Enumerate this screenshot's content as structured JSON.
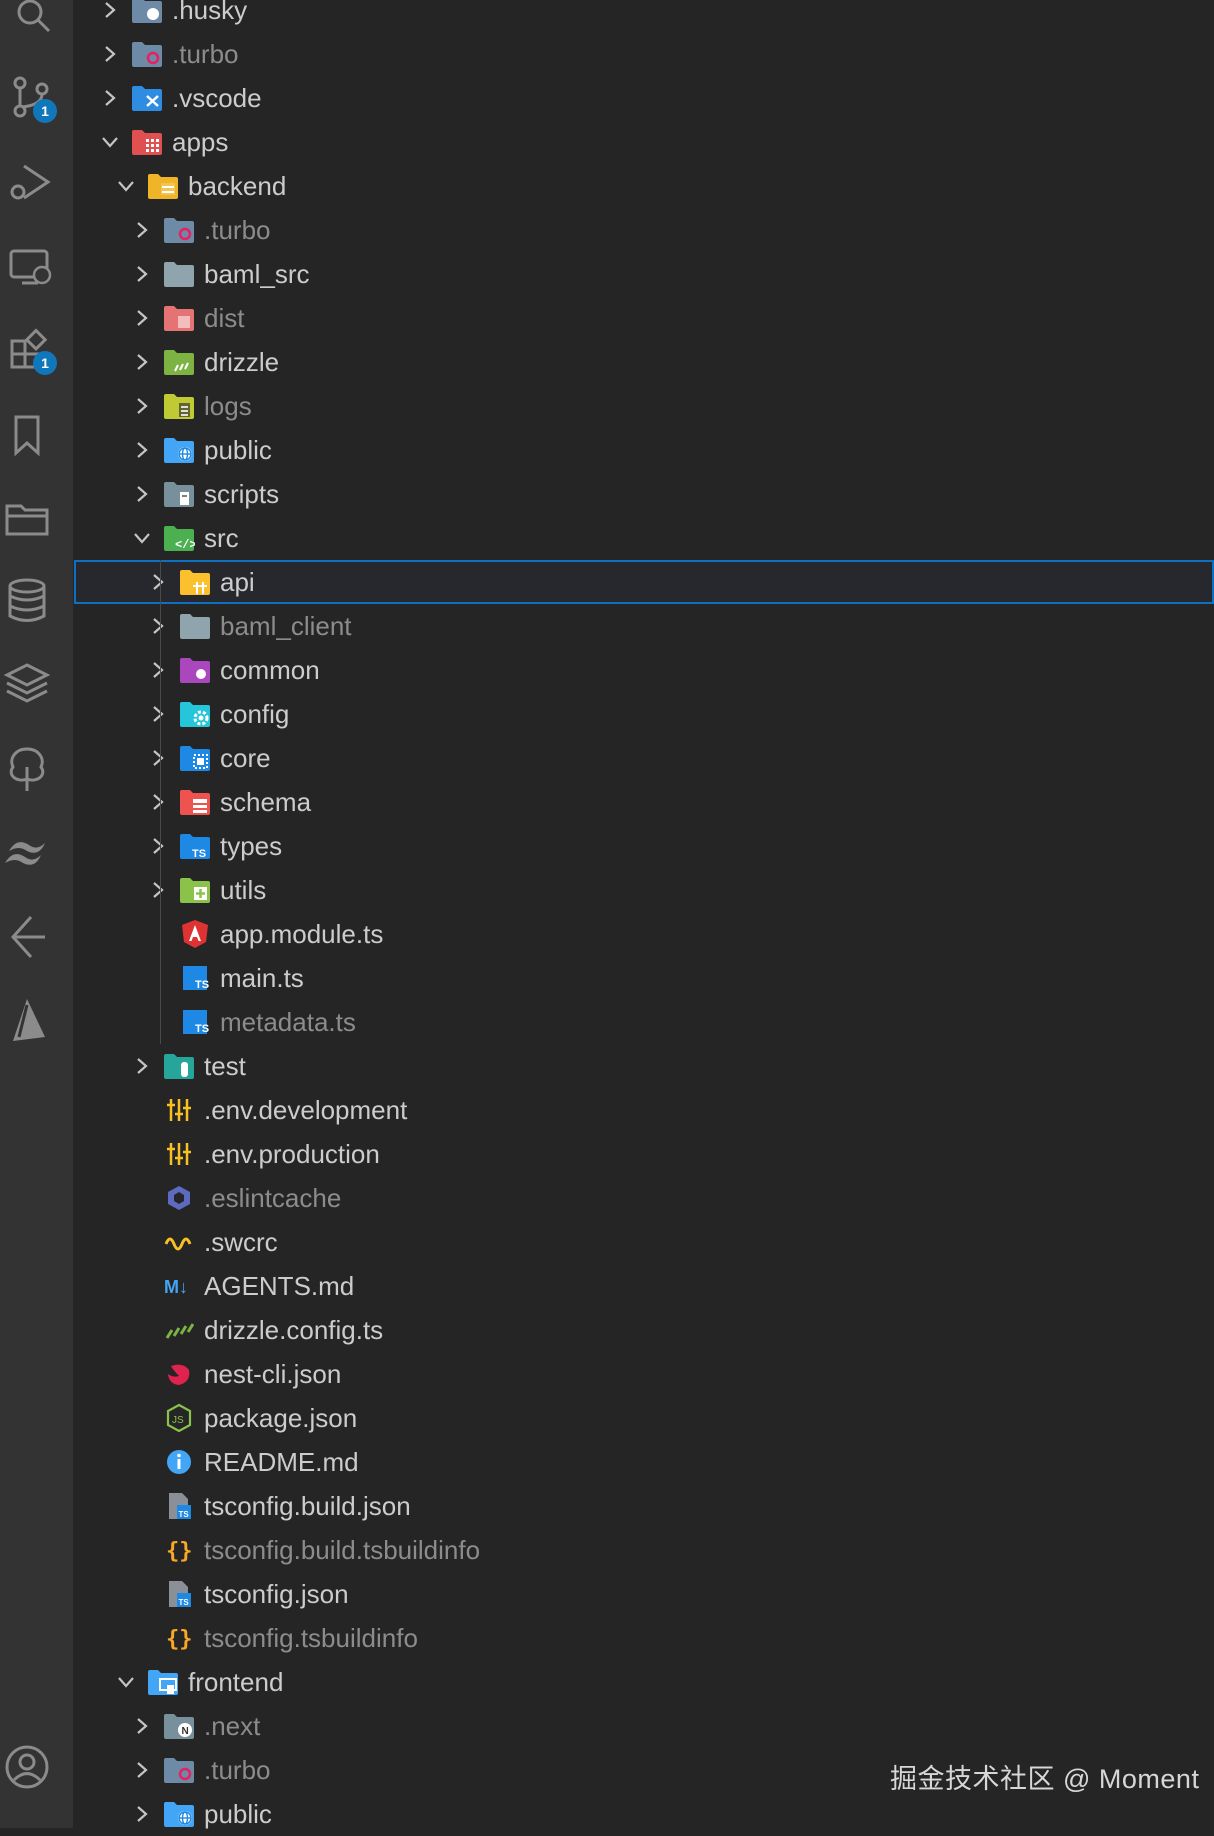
{
  "activity_bar": {
    "source_control_badge": "1",
    "extensions_badge": "1"
  },
  "tree": [
    {
      "label": ".husky",
      "depth": 1,
      "expanded": false,
      "kind": "folder",
      "icon": "husky-folder-icon",
      "color": "#6d8aa6",
      "dim": false
    },
    {
      "label": ".turbo",
      "depth": 1,
      "expanded": false,
      "kind": "folder",
      "icon": "turbo-folder-icon",
      "color": "#6d8aa6",
      "dim": true
    },
    {
      "label": ".vscode",
      "depth": 1,
      "expanded": false,
      "kind": "folder",
      "icon": "vscode-folder-icon",
      "color": "#2f8ce3",
      "dim": false
    },
    {
      "label": "apps",
      "depth": 1,
      "expanded": true,
      "kind": "folder",
      "icon": "apps-folder-icon",
      "color": "#e05050",
      "dim": false
    },
    {
      "label": "backend",
      "depth": 2,
      "expanded": true,
      "kind": "folder",
      "icon": "backend-folder-icon",
      "color": "#f0b429",
      "dim": false
    },
    {
      "label": ".turbo",
      "depth": 3,
      "expanded": false,
      "kind": "folder",
      "icon": "turbo-folder-icon",
      "color": "#6d8aa6",
      "dim": true
    },
    {
      "label": "baml_src",
      "depth": 3,
      "expanded": false,
      "kind": "folder",
      "icon": "folder-icon",
      "color": "#90a4ae",
      "dim": false
    },
    {
      "label": "dist",
      "depth": 3,
      "expanded": false,
      "kind": "folder",
      "icon": "dist-folder-icon",
      "color": "#e57373",
      "dim": true
    },
    {
      "label": "drizzle",
      "depth": 3,
      "expanded": false,
      "kind": "folder",
      "icon": "drizzle-folder-icon",
      "color": "#7cb342",
      "dim": false
    },
    {
      "label": "logs",
      "depth": 3,
      "expanded": false,
      "kind": "folder",
      "icon": "logs-folder-icon",
      "color": "#c0ca33",
      "dim": true
    },
    {
      "label": "public",
      "depth": 3,
      "expanded": false,
      "kind": "folder",
      "icon": "public-folder-icon",
      "color": "#42a5f5",
      "dim": false
    },
    {
      "label": "scripts",
      "depth": 3,
      "expanded": false,
      "kind": "folder",
      "icon": "scripts-folder-icon",
      "color": "#78909c",
      "dim": false
    },
    {
      "label": "src",
      "depth": 3,
      "expanded": true,
      "kind": "folder",
      "icon": "src-folder-icon",
      "color": "#4caf50",
      "dim": false
    },
    {
      "label": "api",
      "depth": 4,
      "expanded": false,
      "kind": "folder",
      "icon": "api-folder-icon",
      "color": "#fbc02d",
      "dim": false,
      "selected": true
    },
    {
      "label": "baml_client",
      "depth": 4,
      "expanded": false,
      "kind": "folder",
      "icon": "folder-icon",
      "color": "#90a4ae",
      "dim": true
    },
    {
      "label": "common",
      "depth": 4,
      "expanded": false,
      "kind": "folder",
      "icon": "common-folder-icon",
      "color": "#ab47bc",
      "dim": false
    },
    {
      "label": "config",
      "depth": 4,
      "expanded": false,
      "kind": "folder",
      "icon": "config-folder-icon",
      "color": "#26c6da",
      "dim": false
    },
    {
      "label": "core",
      "depth": 4,
      "expanded": false,
      "kind": "folder",
      "icon": "core-folder-icon",
      "color": "#1e88e5",
      "dim": false
    },
    {
      "label": "schema",
      "depth": 4,
      "expanded": false,
      "kind": "folder",
      "icon": "schema-folder-icon",
      "color": "#ef5350",
      "dim": false
    },
    {
      "label": "types",
      "depth": 4,
      "expanded": false,
      "kind": "folder",
      "icon": "types-folder-icon",
      "color": "#1e88e5",
      "dim": false
    },
    {
      "label": "utils",
      "depth": 4,
      "expanded": false,
      "kind": "folder",
      "icon": "utils-folder-icon",
      "color": "#8bc34a",
      "dim": false
    },
    {
      "label": "app.module.ts",
      "depth": 4,
      "kind": "file",
      "icon": "angular-icon",
      "color": "#dd3333",
      "dim": false
    },
    {
      "label": "main.ts",
      "depth": 4,
      "kind": "file",
      "icon": "typescript-icon",
      "color": "#1e88e5",
      "dim": false
    },
    {
      "label": "metadata.ts",
      "depth": 4,
      "kind": "file",
      "icon": "typescript-icon",
      "color": "#1e88e5",
      "dim": true
    },
    {
      "label": "test",
      "depth": 3,
      "expanded": false,
      "kind": "folder",
      "icon": "test-folder-icon",
      "color": "#26a69a",
      "dim": false
    },
    {
      "label": ".env.development",
      "depth": 3,
      "kind": "file",
      "icon": "env-icon",
      "color": "#f9c023",
      "dim": false
    },
    {
      "label": ".env.production",
      "depth": 3,
      "kind": "file",
      "icon": "env-icon",
      "color": "#f9c023",
      "dim": false
    },
    {
      "label": ".eslintcache",
      "depth": 3,
      "kind": "file",
      "icon": "eslint-icon",
      "color": "#5c6bc0",
      "dim": true
    },
    {
      "label": ".swcrc",
      "depth": 3,
      "kind": "file",
      "icon": "swc-icon",
      "color": "#f9c023",
      "dim": false
    },
    {
      "label": "AGENTS.md",
      "depth": 3,
      "kind": "file",
      "icon": "markdown-icon",
      "color": "#42a5f5",
      "dim": false
    },
    {
      "label": "drizzle.config.ts",
      "depth": 3,
      "kind": "file",
      "icon": "drizzle-icon",
      "color": "#7cb342",
      "dim": false
    },
    {
      "label": "nest-cli.json",
      "depth": 3,
      "kind": "file",
      "icon": "nest-icon",
      "color": "#e0234e",
      "dim": false
    },
    {
      "label": "package.json",
      "depth": 3,
      "kind": "file",
      "icon": "nodejs-icon",
      "color": "#8bc34a",
      "dim": false
    },
    {
      "label": "README.md",
      "depth": 3,
      "kind": "file",
      "icon": "info-icon",
      "color": "#42a5f5",
      "dim": false
    },
    {
      "label": "tsconfig.build.json",
      "depth": 3,
      "kind": "file",
      "icon": "tsconfig-icon",
      "color": "#1e88e5",
      "dim": false
    },
    {
      "label": "tsconfig.build.tsbuildinfo",
      "depth": 3,
      "kind": "file",
      "icon": "braces-icon",
      "color": "#f9a825",
      "dim": true
    },
    {
      "label": "tsconfig.json",
      "depth": 3,
      "kind": "file",
      "icon": "tsconfig-icon",
      "color": "#1e88e5",
      "dim": false
    },
    {
      "label": "tsconfig.tsbuildinfo",
      "depth": 3,
      "kind": "file",
      "icon": "braces-icon",
      "color": "#f9a825",
      "dim": true
    },
    {
      "label": "frontend",
      "depth": 2,
      "expanded": true,
      "kind": "folder",
      "icon": "frontend-folder-icon",
      "color": "#42a5f5",
      "dim": false
    },
    {
      "label": ".next",
      "depth": 3,
      "expanded": false,
      "kind": "folder",
      "icon": "next-folder-icon",
      "color": "#78909c",
      "dim": true
    },
    {
      "label": ".turbo",
      "depth": 3,
      "expanded": false,
      "kind": "folder",
      "icon": "turbo-folder-icon",
      "color": "#6d8aa6",
      "dim": true
    },
    {
      "label": "public",
      "depth": 3,
      "expanded": false,
      "kind": "folder",
      "icon": "public-folder-icon",
      "color": "#42a5f5",
      "dim": false
    }
  ],
  "watermark": "掘金技术社区 @ Moment"
}
